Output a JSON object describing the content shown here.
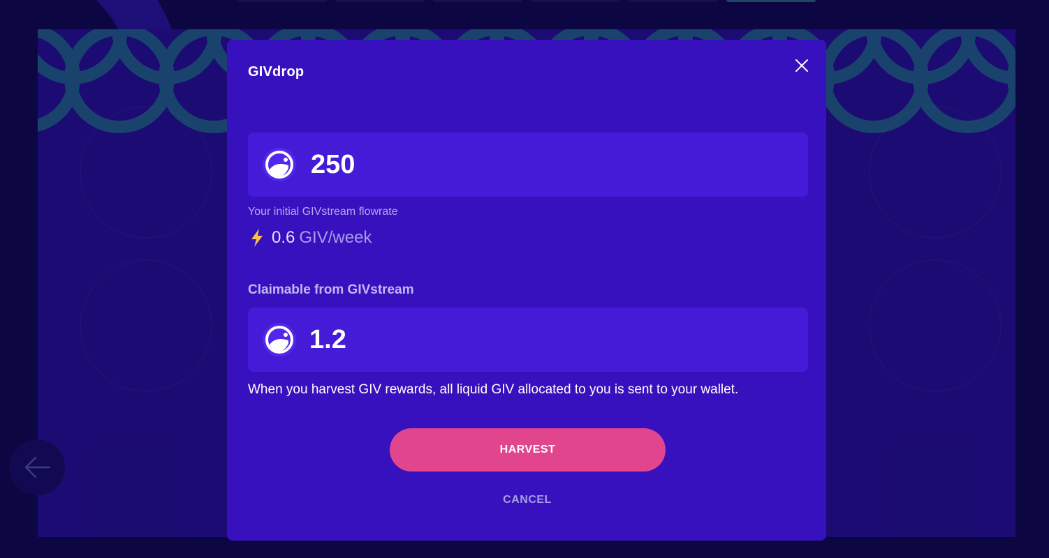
{
  "modal": {
    "title": "GIVdrop",
    "close_icon": "close-icon",
    "givdrop_amount": "250",
    "flowrate_label": "Your initial GIVstream flowrate",
    "flowrate_value": "0.6",
    "flowrate_unit": "GIV/week",
    "claimable_label": "Claimable from GIVstream",
    "claimable_amount": "1.2",
    "info_text": "When you harvest GIV rewards, all liquid GIV allocated to you is sent to your wallet.",
    "harvest_label": "HARVEST",
    "cancel_label": "CANCEL"
  },
  "background": {
    "back_icon": "arrow-left-icon"
  },
  "colors": {
    "modal_bg": "#3811bf",
    "amount_box_bg": "#461bd8",
    "harvest_button": "#e1458d",
    "flash_icon": "#fdc348",
    "scallop": "#236593"
  }
}
